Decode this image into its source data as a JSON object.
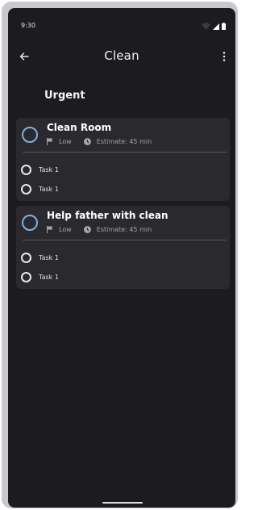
{
  "status_bar": {
    "time": "9:30"
  },
  "app_bar": {
    "title": "Clean",
    "back_icon": "arrow-back-icon",
    "menu_icon": "more-vert-icon"
  },
  "section": {
    "title": "Urgent"
  },
  "tasks": [
    {
      "title": "Clean Room",
      "priority": "Low",
      "estimate": "Estimate: 45 min",
      "subtasks": [
        {
          "label": "Task 1"
        },
        {
          "label": "Task 1"
        }
      ]
    },
    {
      "title": "Help father with clean",
      "priority": "Low",
      "estimate": "Estimate: 45 min",
      "subtasks": [
        {
          "label": "Task 1"
        },
        {
          "label": "Task 1"
        }
      ]
    }
  ],
  "colors": {
    "background": "#1c1b1f",
    "card": "#2a292e",
    "accent": "#7fb0e0",
    "muted_text": "#a5a5aa"
  }
}
